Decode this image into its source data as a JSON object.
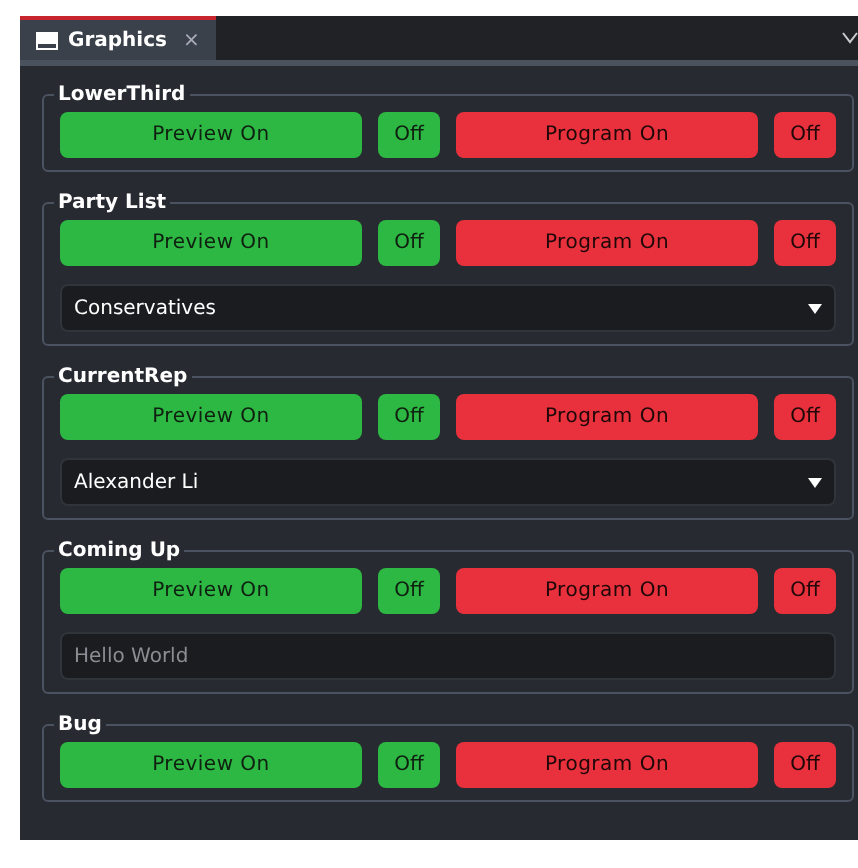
{
  "tabs": [
    {
      "label": "Graphics",
      "close": "×",
      "selected": true
    }
  ],
  "groups": [
    {
      "title": "LowerThird",
      "preview_on": "Preview On",
      "preview_off": "Off",
      "program_on": "Program On",
      "program_off": "Off"
    },
    {
      "title": "Party List",
      "preview_on": "Preview On",
      "preview_off": "Off",
      "program_on": "Program On",
      "program_off": "Off",
      "field": {
        "kind": "dropdown",
        "value": "Conservatives"
      }
    },
    {
      "title": "CurrentRep",
      "preview_on": "Preview On",
      "preview_off": "Off",
      "program_on": "Program On",
      "program_off": "Off",
      "field": {
        "kind": "dropdown",
        "value": "Alexander Li"
      }
    },
    {
      "title": "Coming Up",
      "preview_on": "Preview On",
      "preview_off": "Off",
      "program_on": "Program On",
      "program_off": "Off",
      "field": {
        "kind": "text",
        "placeholder": "Hello World"
      }
    },
    {
      "title": "Bug",
      "preview_on": "Preview On",
      "preview_off": "Off",
      "program_on": "Program On",
      "program_off": "Off"
    }
  ]
}
